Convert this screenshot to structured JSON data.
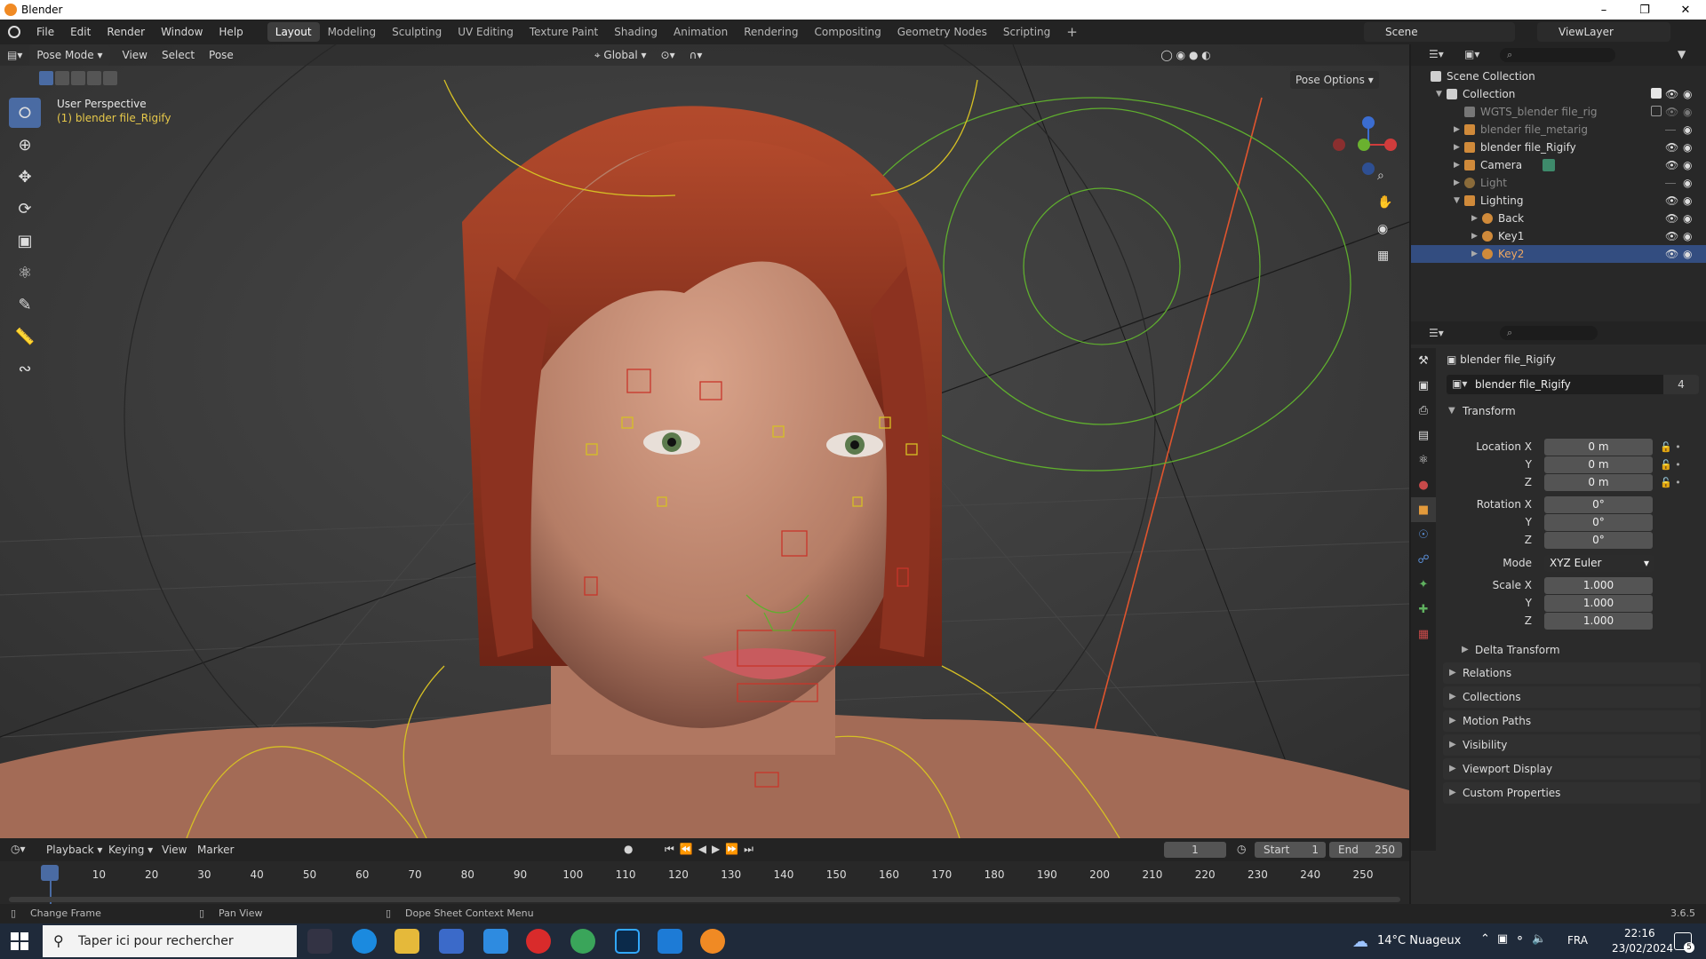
{
  "window": {
    "title": "Blender"
  },
  "menu": [
    "File",
    "Edit",
    "Render",
    "Window",
    "Help"
  ],
  "workspaces": [
    "Layout",
    "Modeling",
    "Sculpting",
    "UV Editing",
    "Texture Paint",
    "Shading",
    "Animation",
    "Rendering",
    "Compositing",
    "Geometry Nodes",
    "Scripting"
  ],
  "scene": {
    "scene_name": "Scene",
    "view_layer": "ViewLayer"
  },
  "viewport_header": {
    "mode": "Pose Mode",
    "view": "View",
    "select": "Select",
    "pose": "Pose",
    "orientation": "Global",
    "pose_options": "Pose Options"
  },
  "viewport": {
    "perspective": "User Perspective",
    "object": "(1) blender file_Rigify"
  },
  "outliner": {
    "rows": [
      {
        "label": "Scene Collection"
      },
      {
        "label": "Collection"
      },
      {
        "label": "WGTS_blender file_rig"
      },
      {
        "label": "blender file_metarig"
      },
      {
        "label": "blender file_Rigify"
      },
      {
        "label": "Camera"
      },
      {
        "label": "Light"
      },
      {
        "label": "Lighting"
      },
      {
        "label": "Back"
      },
      {
        "label": "Key1"
      },
      {
        "label": "Key2"
      }
    ]
  },
  "properties": {
    "object_name": "blender file_Rigify",
    "data_name": "blender file_Rigify",
    "users": "4",
    "transform_label": "Transform",
    "location": {
      "label": "Location X",
      "x": "0 m",
      "y": "0 m",
      "z": "0 m"
    },
    "rotation": {
      "label": "Rotation X",
      "x": "0°",
      "y": "0°",
      "z": "0°"
    },
    "mode": {
      "label": "Mode",
      "value": "XYZ Euler"
    },
    "scale": {
      "label": "Scale X",
      "x": "1.000",
      "y": "1.000",
      "z": "1.000"
    },
    "axis_y": "Y",
    "axis_z": "Z",
    "panels": [
      "Delta Transform",
      "Relations",
      "Collections",
      "Motion Paths",
      "Visibility",
      "Viewport Display",
      "Custom Properties"
    ]
  },
  "timeline": {
    "menus": [
      "Playback",
      "Keying",
      "View",
      "Marker"
    ],
    "current_frame": "1",
    "start_label": "Start",
    "start": "1",
    "end_label": "End",
    "end": "250",
    "ticks": [
      "1",
      "10",
      "20",
      "30",
      "40",
      "50",
      "60",
      "70",
      "80",
      "90",
      "100",
      "110",
      "120",
      "130",
      "140",
      "150",
      "160",
      "170",
      "180",
      "190",
      "200",
      "210",
      "220",
      "230",
      "240",
      "250"
    ]
  },
  "status": {
    "change_frame": "Change Frame",
    "pan_view": "Pan View",
    "context_menu": "Dope Sheet Context Menu",
    "version": "3.6.5"
  },
  "taskbar": {
    "search_placeholder": "Taper ici pour rechercher",
    "weather": "14°C Nuageux",
    "lang": "FRA",
    "time": "22:16",
    "date": "23/02/2024",
    "notifications": "5"
  }
}
